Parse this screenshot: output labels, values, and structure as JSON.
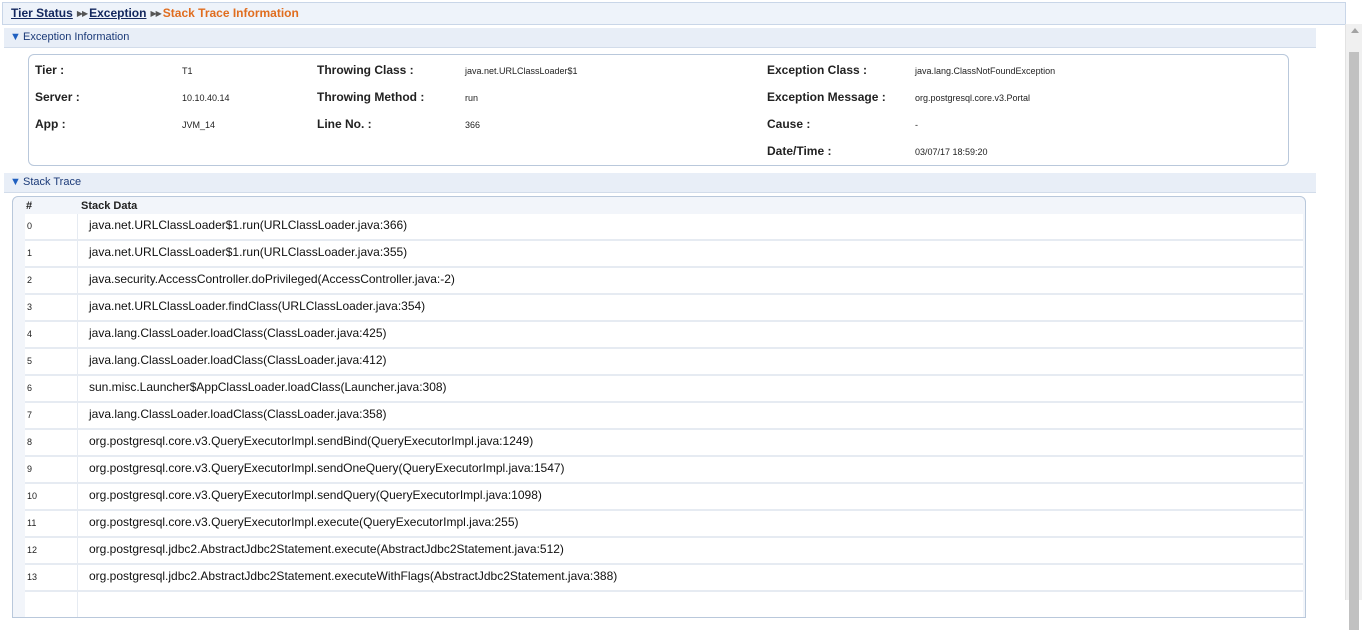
{
  "breadcrumb": {
    "items": [
      "Tier Status",
      "Exception"
    ],
    "current": "Stack Trace Information"
  },
  "exception_section": {
    "title": "Exception Information",
    "fields": {
      "tier": {
        "label": "Tier :",
        "value": "T1"
      },
      "server": {
        "label": "Server :",
        "value": "10.10.40.14"
      },
      "app": {
        "label": "App :",
        "value": "JVM_14"
      },
      "throwing_class": {
        "label": "Throwing Class :",
        "value": "java.net.URLClassLoader$1"
      },
      "throwing_method": {
        "label": "Throwing Method :",
        "value": "run"
      },
      "line_no": {
        "label": "Line No. :",
        "value": "366"
      },
      "exception_class": {
        "label": "Exception Class :",
        "value": "java.lang.ClassNotFoundException"
      },
      "exception_message": {
        "label": "Exception Message :",
        "value": "org.postgresql.core.v3.Portal"
      },
      "cause": {
        "label": "Cause :",
        "value": "-"
      },
      "datetime": {
        "label": "Date/Time :",
        "value": "03/07/17 18:59:20"
      }
    }
  },
  "stack_section": {
    "title": "Stack Trace",
    "columns": [
      "#",
      "Stack Data"
    ],
    "rows": [
      {
        "idx": "0",
        "data": "java.net.URLClassLoader$1.run(URLClassLoader.java:366)"
      },
      {
        "idx": "1",
        "data": "java.net.URLClassLoader$1.run(URLClassLoader.java:355)"
      },
      {
        "idx": "2",
        "data": "java.security.AccessController.doPrivileged(AccessController.java:-2)"
      },
      {
        "idx": "3",
        "data": "java.net.URLClassLoader.findClass(URLClassLoader.java:354)"
      },
      {
        "idx": "4",
        "data": "java.lang.ClassLoader.loadClass(ClassLoader.java:425)"
      },
      {
        "idx": "5",
        "data": "java.lang.ClassLoader.loadClass(ClassLoader.java:412)"
      },
      {
        "idx": "6",
        "data": "sun.misc.Launcher$AppClassLoader.loadClass(Launcher.java:308)"
      },
      {
        "idx": "7",
        "data": "java.lang.ClassLoader.loadClass(ClassLoader.java:358)"
      },
      {
        "idx": "8",
        "data": "org.postgresql.core.v3.QueryExecutorImpl.sendBind(QueryExecutorImpl.java:1249)"
      },
      {
        "idx": "9",
        "data": "org.postgresql.core.v3.QueryExecutorImpl.sendOneQuery(QueryExecutorImpl.java:1547)"
      },
      {
        "idx": "10",
        "data": "org.postgresql.core.v3.QueryExecutorImpl.sendQuery(QueryExecutorImpl.java:1098)"
      },
      {
        "idx": "11",
        "data": "org.postgresql.core.v3.QueryExecutorImpl.execute(QueryExecutorImpl.java:255)"
      },
      {
        "idx": "12",
        "data": "org.postgresql.jdbc2.AbstractJdbc2Statement.execute(AbstractJdbc2Statement.java:512)"
      },
      {
        "idx": "13",
        "data": "org.postgresql.jdbc2.AbstractJdbc2Statement.executeWithFlags(AbstractJdbc2Statement.java:388)"
      }
    ]
  },
  "icons": {
    "breadcrumb_separator": "double-chevron-right-icon",
    "section_toggle": "triangle-down-icon"
  },
  "colors": {
    "breadcrumb_current": "#e06d1f",
    "link": "#13275e",
    "section_header_bg": "#e8eef7"
  }
}
